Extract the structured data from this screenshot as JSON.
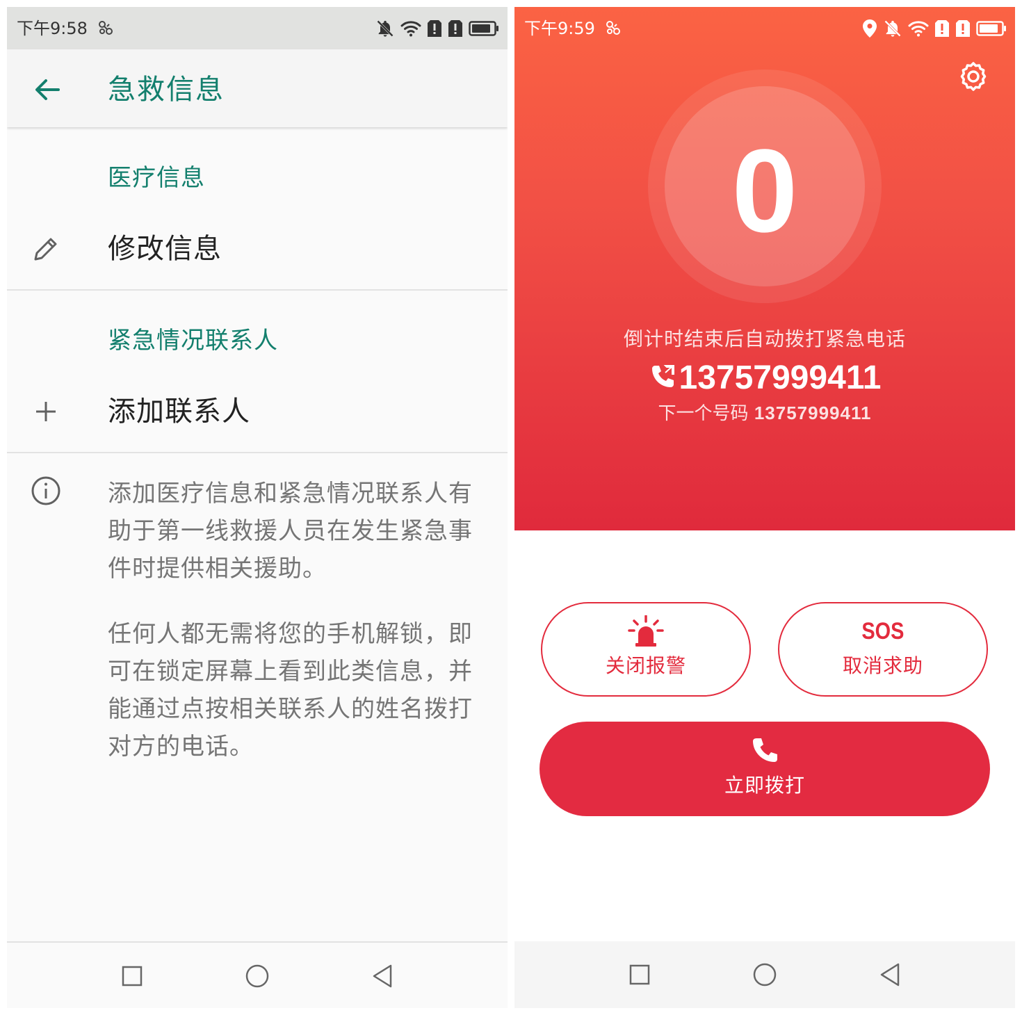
{
  "left": {
    "status_bar": {
      "time": "下午9:58"
    },
    "app_bar": {
      "title": "急救信息"
    },
    "medical_section": {
      "header": "医疗信息",
      "edit_label": "修改信息"
    },
    "contacts_section": {
      "header": "紧急情况联系人",
      "add_label": "添加联系人"
    },
    "info": {
      "paragraph_1": "添加医疗信息和紧急情况联系人有助于第一线救援人员在发生紧急事件时提供相关援助。",
      "paragraph_2": "任何人都无需将您的手机解锁，即可在锁定屏幕上看到此类信息，并能通过点按相关联系人的姓名拨打对方的电话。"
    }
  },
  "right": {
    "status_bar": {
      "time": "下午9:59"
    },
    "countdown": {
      "value": "0"
    },
    "hint": "倒计时结束后自动拨打紧急电话",
    "phone_number": "13757999411",
    "next_number": {
      "label": "下一个号码",
      "number": "13757999411"
    },
    "buttons": {
      "alarm_off": "关闭报警",
      "sos_icon_text": "SOS",
      "cancel_help": "取消求助",
      "call_now": "立即拨打"
    }
  },
  "colors": {
    "accent_green": "#137f6d",
    "sos_red": "#e32b3d",
    "hero_top": "#fb6344",
    "hero_bottom": "#e02a3c"
  },
  "icons": {
    "left": [
      "back-arrow-icon",
      "pencil-icon",
      "plus-icon",
      "info-icon"
    ],
    "right": [
      "gear-icon",
      "phone-outgoing-icon",
      "siren-icon",
      "phone-icon"
    ],
    "status": [
      "screenshot-icon",
      "location-icon",
      "bell-off-icon",
      "wifi-icon",
      "sim-alert-icon",
      "battery-icon"
    ],
    "navigation": [
      "recent-apps-icon",
      "home-icon",
      "back-icon"
    ]
  }
}
